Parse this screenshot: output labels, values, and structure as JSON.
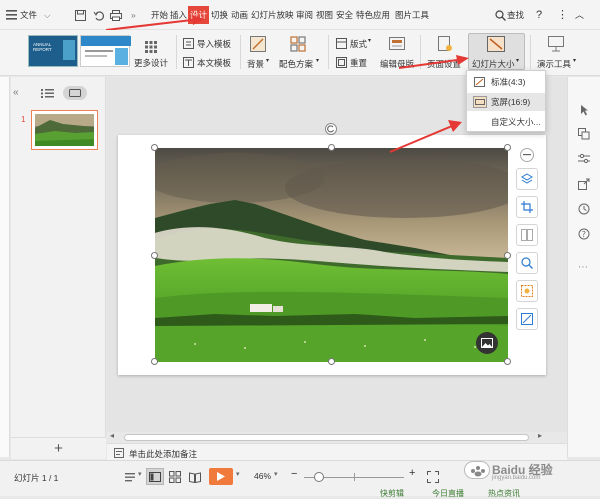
{
  "menubar": {
    "file_label": "文件",
    "tabs": [
      "开始",
      "插入",
      "设计",
      "切换",
      "动画",
      "幻灯片放映",
      "审阅",
      "视图",
      "安全",
      "特色应用",
      "图片工具"
    ],
    "search_label": "查找",
    "help_label": "?"
  },
  "ribbon": {
    "template_thumb_title": "ANNUAL REPORT",
    "more_designs_label": "更多设计",
    "import_template_label": "导入模板",
    "text_template_label": "本文模板",
    "background_label": "背景",
    "color_scheme_label": "配色方案",
    "layout_label": "版式",
    "reset_label": "重置",
    "edit_master_label": "编辑母版",
    "page_setup_label": "页面设置",
    "slide_size_label": "幻灯片大小",
    "presentation_tools_label": "演示工具"
  },
  "dropdown": {
    "items": [
      "标准(4:3)",
      "宽屏(16:9)",
      "自定义大小..."
    ]
  },
  "panel": {
    "slide_number": "1",
    "add_label": "+"
  },
  "notes": {
    "placeholder": "单击此处添加备注"
  },
  "statusbar": {
    "slide_counter": "幻灯片 1 / 1",
    "zoom": "46%",
    "zoom_minus": "−",
    "zoom_plus": "+",
    "watermark": "Baidu 经验",
    "watermark_sub": "jingyan.baidu.com",
    "bottom_texts": [
      "快剪辑",
      "今日直播",
      "热点资讯"
    ]
  },
  "colors": {
    "accent_red": "#e5473a",
    "selection_orange": "#f08050",
    "play_orange": "#f07a3c"
  }
}
